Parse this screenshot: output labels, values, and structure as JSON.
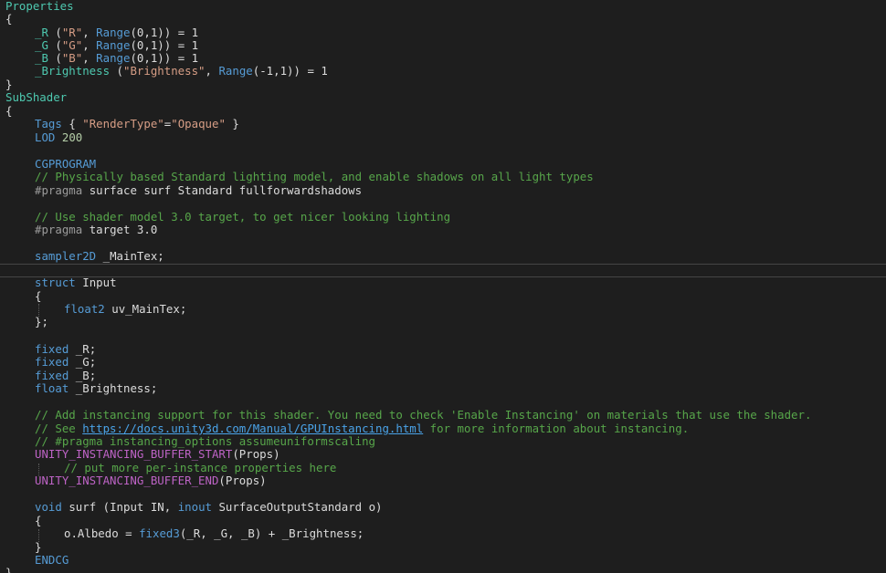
{
  "code": {
    "properties_header": "Properties",
    "open_brace": "{",
    "close_brace": "}",
    "prop_r": {
      "name": "_R",
      "label": "\"R\"",
      "range": "Range",
      "range_args": "(0,1)",
      "value": "= 1"
    },
    "prop_g": {
      "name": "_G",
      "label": "\"G\"",
      "range": "Range",
      "range_args": "(0,1)",
      "value": "= 1"
    },
    "prop_b": {
      "name": "_B",
      "label": "\"B\"",
      "range": "Range",
      "range_args": "(0,1)",
      "value": "= 1"
    },
    "prop_brightness": {
      "name": "_Brightness",
      "label": "\"Brightness\"",
      "range": "Range",
      "range_args": "(-1,1)",
      "value": "= 1"
    },
    "subshader_header": "SubShader",
    "tags": {
      "kw": "Tags",
      "open": "{ ",
      "key": "\"RenderType\"",
      "eq": "=",
      "val": "\"Opaque\"",
      "close": " }"
    },
    "lod": {
      "kw": "LOD",
      "value": "200"
    },
    "cgprogram": "CGPROGRAM",
    "comment_lighting": "// Physically based Standard lighting model, and enable shadows on all light types",
    "pragma_surface": {
      "kw": "#pragma",
      "rest": "surface surf Standard fullforwardshadows"
    },
    "comment_target": "// Use shader model 3.0 target, to get nicer looking lighting",
    "pragma_target": {
      "kw": "#pragma",
      "rest": "target 3.0"
    },
    "sampler": {
      "type": "sampler2D",
      "rest": "_MainTex;"
    },
    "struct_decl": {
      "kw": "struct",
      "name": "Input"
    },
    "struct_field": {
      "type": "float2",
      "rest": "uv_MainTex;"
    },
    "struct_close": "};",
    "fixed_r": {
      "type": "fixed",
      "rest": "_R;"
    },
    "fixed_g": {
      "type": "fixed",
      "rest": "_G;"
    },
    "fixed_b": {
      "type": "fixed",
      "rest": "_B;"
    },
    "float_brightness": {
      "type": "float",
      "rest": "_Brightness;"
    },
    "comment_instancing": "// Add instancing support for this shader. You need to check 'Enable Instancing' on materials that use the shader.",
    "comment_see": {
      "prefix": "// See ",
      "url": "https://docs.unity3d.com/Manual/GPUInstancing.html",
      "suffix": " for more information about instancing."
    },
    "comment_pragma_instancing": "// #pragma instancing_options assumeuniformscaling",
    "buffer_start": {
      "macro": "UNITY_INSTANCING_BUFFER_START",
      "args": "(Props)"
    },
    "comment_per_instance": "// put more per-instance properties here",
    "buffer_end": {
      "macro": "UNITY_INSTANCING_BUFFER_END",
      "args": "(Props)"
    },
    "surf_decl": {
      "kw_void": "void",
      "name": "surf",
      "open": "(Input IN, ",
      "kw_inout": "inout",
      "type": "SurfaceOutputStandard",
      "rest": " o)"
    },
    "albedo": {
      "lhs": "o.Albedo = ",
      "fn": "fixed3",
      "args": "(_R, _G, _B) + _Brightness;"
    },
    "endcg": "ENDCG"
  }
}
